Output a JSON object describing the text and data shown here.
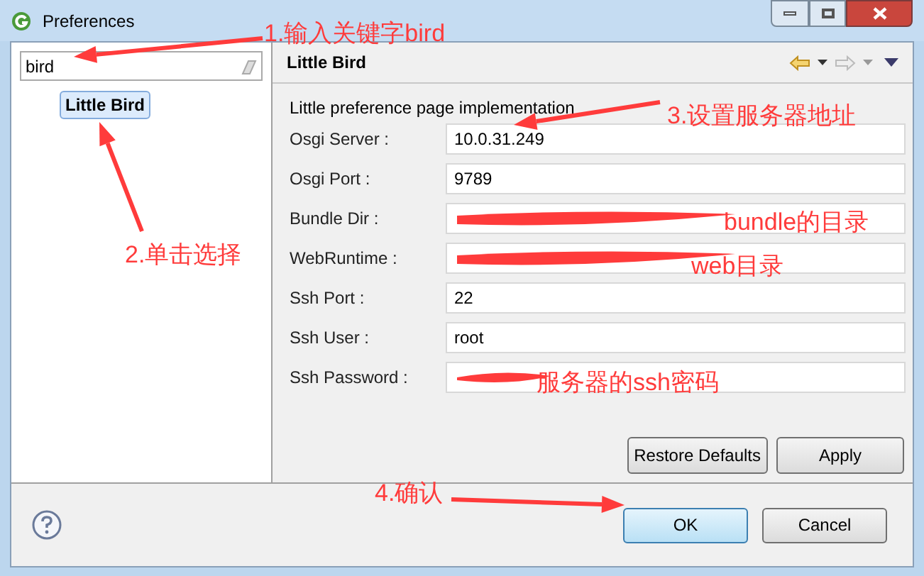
{
  "window": {
    "title": "Preferences"
  },
  "search": {
    "value": "bird"
  },
  "tree": [
    {
      "label": "Little Bird",
      "selected": true
    }
  ],
  "page": {
    "title": "Little Bird",
    "description": "Little preference page implementation"
  },
  "fields": [
    {
      "label": "Osgi Server :",
      "kind": "text",
      "value": "10.0.31.249"
    },
    {
      "label": "Osgi Port :",
      "kind": "text",
      "value": "9789"
    },
    {
      "label": "Bundle Dir :",
      "kind": "redacted"
    },
    {
      "label": "WebRuntime :",
      "kind": "redacted"
    },
    {
      "label": "Ssh Port :",
      "kind": "text",
      "value": "22"
    },
    {
      "label": "Ssh User :",
      "kind": "text",
      "value": "root"
    },
    {
      "label": "Ssh Password :",
      "kind": "redacted"
    }
  ],
  "page_buttons": [
    "Restore Defaults",
    "Apply"
  ],
  "dialog_buttons": [
    {
      "label": "OK",
      "default": true
    },
    {
      "label": "Cancel",
      "default": false
    }
  ],
  "annotations": [
    "1.输入关键字bird",
    "2.单击选择",
    "3.设置服务器地址",
    "bundle的目录",
    "web目录",
    "服务器的ssh密码",
    "4.确认"
  ]
}
